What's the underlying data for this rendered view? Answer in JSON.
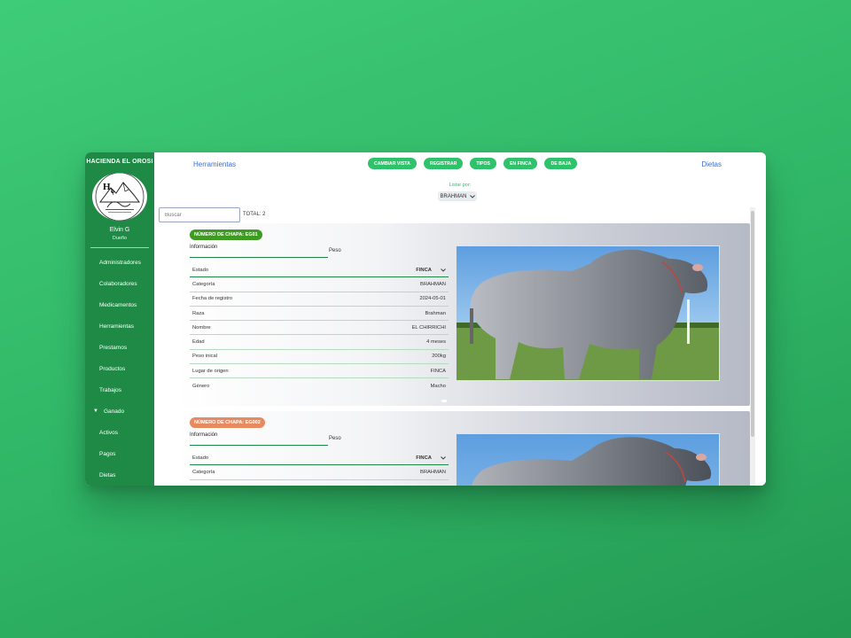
{
  "sidebar": {
    "brand": "HACIENDA EL OROSI",
    "user_name": "Elvin G",
    "user_role": "Dueño",
    "items": [
      {
        "label": "Administradores"
      },
      {
        "label": "Colaboradores"
      },
      {
        "label": "Medicamentos"
      },
      {
        "label": "Herramientas"
      },
      {
        "label": "Prestamos"
      },
      {
        "label": "Productos"
      },
      {
        "label": "Trabajos"
      },
      {
        "label": "Ganado"
      },
      {
        "label": "Activos"
      },
      {
        "label": "Pagos"
      },
      {
        "label": "Dietas"
      }
    ]
  },
  "header": {
    "left_link": "Herramientas",
    "right_link": "Dietas",
    "buttons": [
      "CAMBIAR VISTA",
      "REGISTRAR",
      "TIPOS",
      "EN FINCA",
      "DE BAJA"
    ]
  },
  "filter": {
    "label": "Listar por:",
    "selected": "BRAHMAN"
  },
  "search": {
    "placeholder": "Buscar",
    "total_text": "TOTAL: 2"
  },
  "colors": {
    "sidebar": "#1e8a45",
    "accent": "#2ec26a",
    "badge_green": "#3f9a24",
    "badge_orange": "#e88a5f",
    "link": "#3a6fd8"
  },
  "cards": [
    {
      "badge": "NÚMERO DE CHAPA: EG01",
      "info_label": "Información",
      "peso_label": "Peso",
      "rows": [
        {
          "label": "Estado",
          "value": "FINCA"
        },
        {
          "label": "Categoría",
          "value": "BRAHMAN"
        },
        {
          "label": "Fecha de registro",
          "value": "2024-05-01"
        },
        {
          "label": "Raza",
          "value": "Brahman"
        },
        {
          "label": "Nombre",
          "value": "EL CHIRRICHI"
        },
        {
          "label": "Edad",
          "value": "4 meses"
        },
        {
          "label": "Peso inical",
          "value": "200kg"
        },
        {
          "label": "Lugar de origen",
          "value": "FINCA"
        },
        {
          "label": "Género",
          "value": "Macho"
        }
      ]
    },
    {
      "badge": "NÚMERO DE CHAPA: EG002",
      "info_label": "Información",
      "peso_label": "Peso",
      "rows": [
        {
          "label": "Estado",
          "value": "FINCA"
        },
        {
          "label": "Categoría",
          "value": "BRAHMAN"
        }
      ]
    }
  ]
}
